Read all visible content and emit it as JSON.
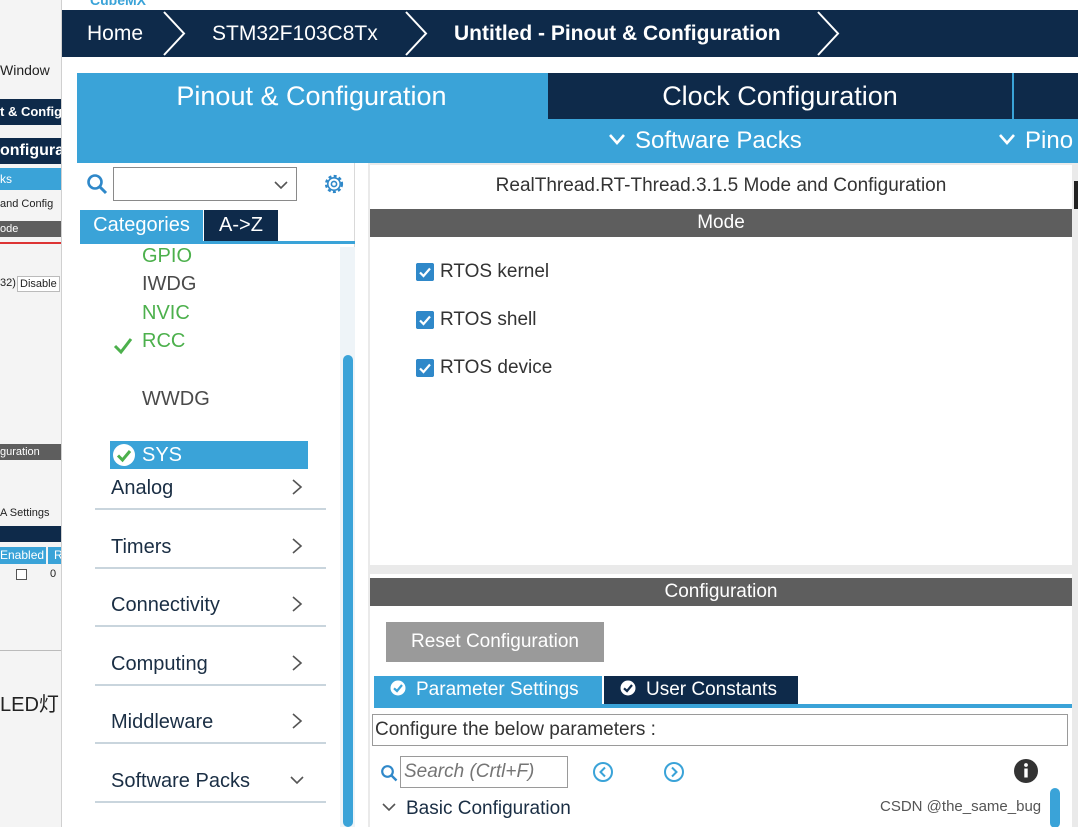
{
  "background_window": {
    "menu_window": "Window",
    "tab_label": "t & Config",
    "bar_label": "onfigurat",
    "blue_bar": "ks",
    "sub_label": " and Config",
    "mode_label": "ode",
    "disable_prefix": "32)",
    "disable_value": "Disable",
    "config_label": "guration",
    "settings_label": "A Settings",
    "enabled_label": "Enabled",
    "r_label": "R",
    "zero_label": "0",
    "bottom_text": "LED灯"
  },
  "header": {
    "app_title": "CubeMX"
  },
  "breadcrumb": {
    "home": "Home",
    "device": "STM32F103C8Tx",
    "current": "Untitled - Pinout & Configuration"
  },
  "main_tabs": {
    "pinout": "Pinout & Configuration",
    "clock": "Clock Configuration"
  },
  "sub_menu": {
    "software_packs": "Software Packs",
    "pinout": "Pino"
  },
  "left_panel": {
    "search_value": "",
    "tab_categories": "Categories",
    "tab_az": "A->Z",
    "tree_items": {
      "gpio": "GPIO",
      "iwdg": "IWDG",
      "nvic": "NVIC",
      "rcc": "RCC",
      "sys": "SYS",
      "wwdg": "WWDG"
    },
    "categories": {
      "analog": "Analog",
      "timers": "Timers",
      "connectivity": "Connectivity",
      "computing": "Computing",
      "middleware": "Middleware",
      "software_packs": "Software Packs"
    }
  },
  "mode_pane": {
    "title": "RealThread.RT-Thread.3.1.5 Mode and Configuration",
    "header": "Mode",
    "options": {
      "rtos_kernel": "RTOS kernel",
      "rtos_shell": "RTOS shell",
      "rtos_device": "RTOS device"
    }
  },
  "config_pane": {
    "header": "Configuration",
    "reset_button": "Reset Configuration",
    "tab_parameters": "Parameter Settings",
    "tab_user_constants": "User Constants",
    "description": "Configure the below parameters :",
    "search_placeholder": "Search (Crtl+F)",
    "basic_configuration": "Basic Configuration"
  },
  "colors": {
    "navy": "#0e2a4a",
    "accent_blue": "#3aa3d8",
    "green": "#4cb04c",
    "header_gray": "#5e5e5e"
  },
  "watermark": "CSDN @the_same_bug"
}
